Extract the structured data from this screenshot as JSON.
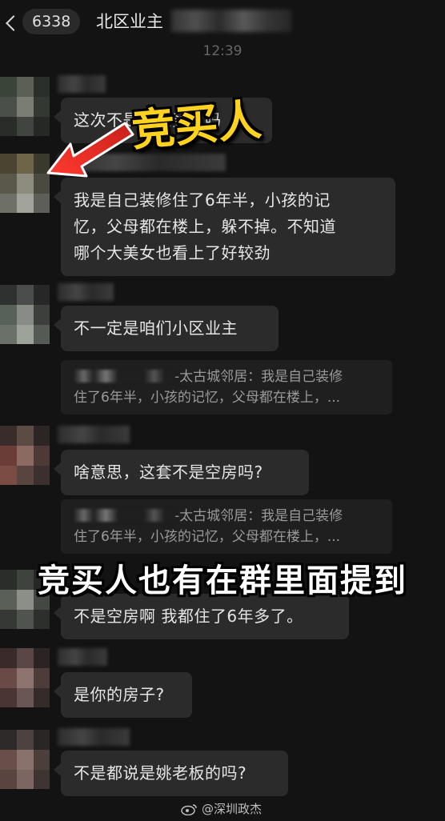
{
  "header": {
    "unread_count": "6338",
    "title": "北区业主",
    "time": "12:39"
  },
  "overlay": {
    "top_caption": "竞买人",
    "middle_caption": "竞买人也有在群里面提到"
  },
  "messages": [
    {
      "text": "这次不是被人买走吗"
    },
    {
      "text": "我是自己装修住了6年半，小孩的记忆，父母都在楼上，躲不掉。不知道哪个大美女也看上了好较劲",
      "lines": [
        "我是自己装修住了6年半，小孩的记",
        "忆，父母都在楼上，躲不掉。不知道",
        "哪个大美女也看上了好较劲"
      ]
    },
    {
      "text": "不一定是咱们小区业主",
      "quote": {
        "sender": "-太古城邻居：",
        "line1": "我是自己装修",
        "line2": "住了6年半，小孩的记忆，父母都在楼上，..."
      }
    },
    {
      "text": "啥意思，这套不是空房吗?",
      "quote": {
        "sender": "-太古城邻居：",
        "line1": "我是自己装修",
        "line2": "住了6年半，小孩的记忆，父母都在楼上，..."
      }
    },
    {
      "text": "不是空房啊 我都住了6年多了。"
    },
    {
      "text": "是你的房子?"
    },
    {
      "text": "不是都说是姚老板的吗?"
    }
  ],
  "watermark": "@深圳政杰",
  "colors": {
    "background": "#131313",
    "bubble": "#2b2b2b",
    "caption_yellow": "#ffd21f",
    "arrow_red": "#e8322a"
  },
  "icons": [
    "back-chevron-icon",
    "weibo-icon",
    "red-arrow"
  ]
}
